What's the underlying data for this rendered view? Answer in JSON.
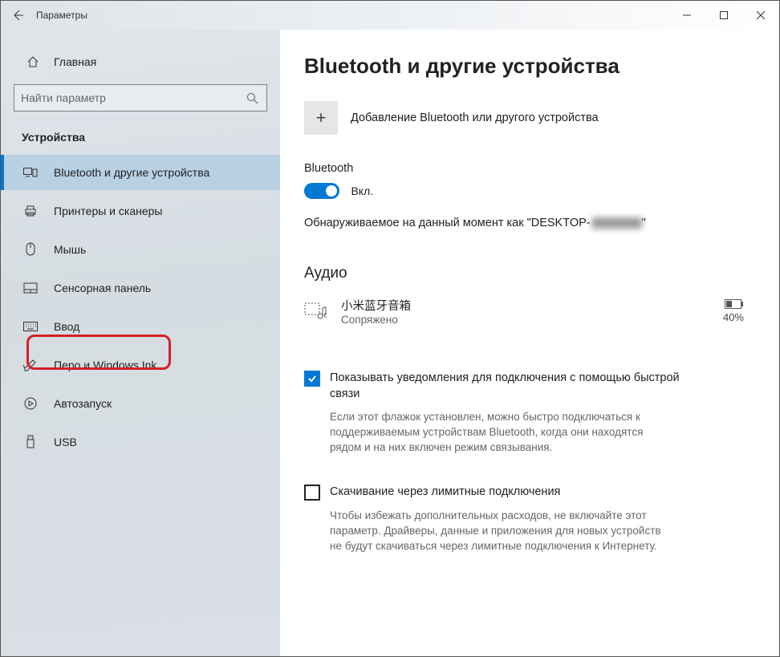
{
  "titlebar": {
    "title": "Параметры"
  },
  "sidebar": {
    "home_label": "Главная",
    "search_placeholder": "Найти параметр",
    "category": "Устройства",
    "items": [
      {
        "label": "Bluetooth и другие устройства"
      },
      {
        "label": "Принтеры и сканеры"
      },
      {
        "label": "Мышь"
      },
      {
        "label": "Сенсорная панель"
      },
      {
        "label": "Ввод"
      },
      {
        "label": "Перо и Windows Ink"
      },
      {
        "label": "Автозапуск"
      },
      {
        "label": "USB"
      }
    ]
  },
  "main": {
    "heading": "Bluetooth и другие устройства",
    "add_label": "Добавление Bluetooth или другого устройства",
    "bt_label": "Bluetooth",
    "toggle_state": "Вкл.",
    "discoverable_prefix": "Обнаруживаемое на данный момент как \"DESKTOP-",
    "discoverable_suffix": "\"",
    "section_audio": "Аудио",
    "device": {
      "name": "小米蓝牙音箱",
      "status": "Сопряжено",
      "battery": "40%"
    },
    "check1": {
      "label": "Показывать уведомления для подключения с помощью быстрой связи",
      "desc": "Если этот флажок установлен, можно быстро подключаться к поддерживаемым устройствам Bluetooth, когда они находятся рядом и на них включен режим связывания."
    },
    "check2": {
      "label": "Скачивание через лимитные подключения",
      "desc": "Чтобы избежать дополнительных расходов, не включайте этот параметр. Драйверы, данные и приложения для новых устройств не будут скачиваться через лимитные подключения к Интернету."
    }
  }
}
